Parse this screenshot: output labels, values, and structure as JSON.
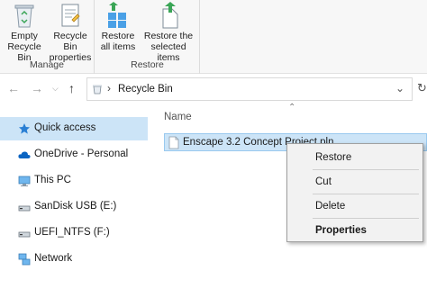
{
  "ribbon": {
    "manage": {
      "empty_label": "Empty\nRecycle Bin",
      "properties_label": "Recycle Bin\nproperties",
      "group_label": "Manage"
    },
    "restore": {
      "restore_all_label": "Restore\nall items",
      "restore_selected_label": "Restore the\nselected items",
      "group_label": "Restore"
    }
  },
  "address": {
    "path": "Recycle Bin"
  },
  "nav": {
    "items": [
      {
        "label": "Quick access",
        "icon": "star-icon"
      },
      {
        "label": "OneDrive - Personal",
        "icon": "cloud-icon"
      },
      {
        "label": "This PC",
        "icon": "computer-icon"
      },
      {
        "label": "SanDisk USB (E:)",
        "icon": "drive-icon"
      },
      {
        "label": "UEFI_NTFS (F:)",
        "icon": "drive-icon"
      },
      {
        "label": "Network",
        "icon": "network-icon"
      }
    ]
  },
  "content": {
    "column_name": "Name",
    "files": [
      {
        "name": "Enscape 3.2 Concept Project.pln"
      }
    ]
  },
  "context_menu": {
    "items": [
      "Restore",
      "Cut",
      "Delete",
      "Properties"
    ]
  },
  "colors": {
    "selection": "#cce4f7",
    "accent_blue": "#0078d7",
    "green_arrow": "#3aa556"
  }
}
